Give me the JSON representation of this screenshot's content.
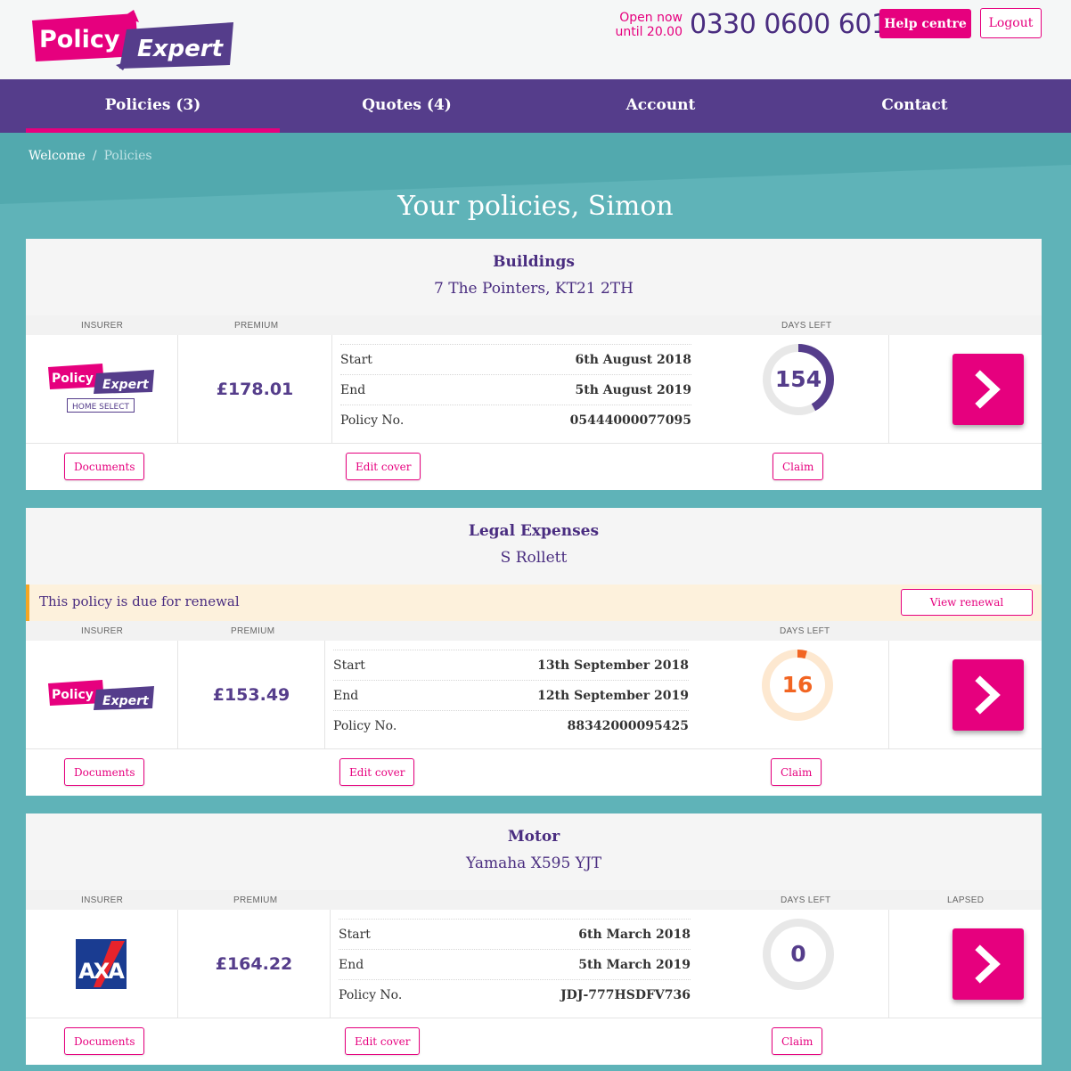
{
  "header": {
    "logo": {
      "word1": "Policy",
      "word2": "Expert"
    },
    "hours_line1": "Open now",
    "hours_line2": "until 20.00",
    "phone": "0330 0600 601",
    "help_label": "Help centre",
    "logout_label": "Logout"
  },
  "nav": {
    "items": [
      {
        "label": "Policies (3)"
      },
      {
        "label": "Quotes (4)"
      },
      {
        "label": "Account"
      },
      {
        "label": "Contact"
      }
    ]
  },
  "breadcrumb": {
    "home": "Welcome",
    "separator": "/",
    "current": "Policies"
  },
  "page_title": "Your policies, Simon",
  "column_labels": {
    "insurer": "Insurer",
    "premium": "Premium",
    "days_left": "Days left",
    "lapsed": "Lapsed"
  },
  "detail_labels": {
    "start": "Start",
    "end": "End",
    "policy_no": "Policy No."
  },
  "action_labels": {
    "documents": "Documents",
    "edit_cover": "Edit cover",
    "claim": "Claim"
  },
  "policies": [
    {
      "type": "Buildings",
      "subject": "7 The Pointers, KT21 2TH",
      "insurer": "Policy Expert Home Select",
      "insurer_badge": "HOME SELECT",
      "premium": "£178.01",
      "start": "6th August 2018",
      "end": "5th August 2019",
      "policy_no": "05444000077095",
      "days_left": "154",
      "days_fraction": 0.42,
      "donut_color": "#553d8b",
      "donut_track": "#e8e8e8",
      "number_color": "#553d8b"
    },
    {
      "type": "Legal Expenses",
      "subject": "S Rollett",
      "insurer": "Policy Expert",
      "premium": "£153.49",
      "start": "13th September 2018",
      "end": "12th September 2019",
      "policy_no": "88342000095425",
      "days_left": "16",
      "days_fraction": 0.044,
      "donut_color": "#f26522",
      "donut_track": "#fde8d0",
      "number_color": "#f26522",
      "renewal_text": "This policy is due for renewal",
      "renewal_button": "View renewal"
    },
    {
      "type": "Motor",
      "subject": "Yamaha X595 YJT",
      "insurer": "AXA",
      "premium": "£164.22",
      "start": "6th March 2018",
      "end": "5th March 2019",
      "policy_no": "JDJ-777HSDFV736",
      "days_left": "0",
      "days_fraction": 0,
      "donut_color": "#553d8b",
      "donut_track": "#e8e8e8",
      "number_color": "#553d8b",
      "status": "Lapsed"
    }
  ],
  "colors": {
    "brand_pink": "#e6007e",
    "brand_purple": "#553d8b",
    "teal": "#5fb3b8"
  }
}
